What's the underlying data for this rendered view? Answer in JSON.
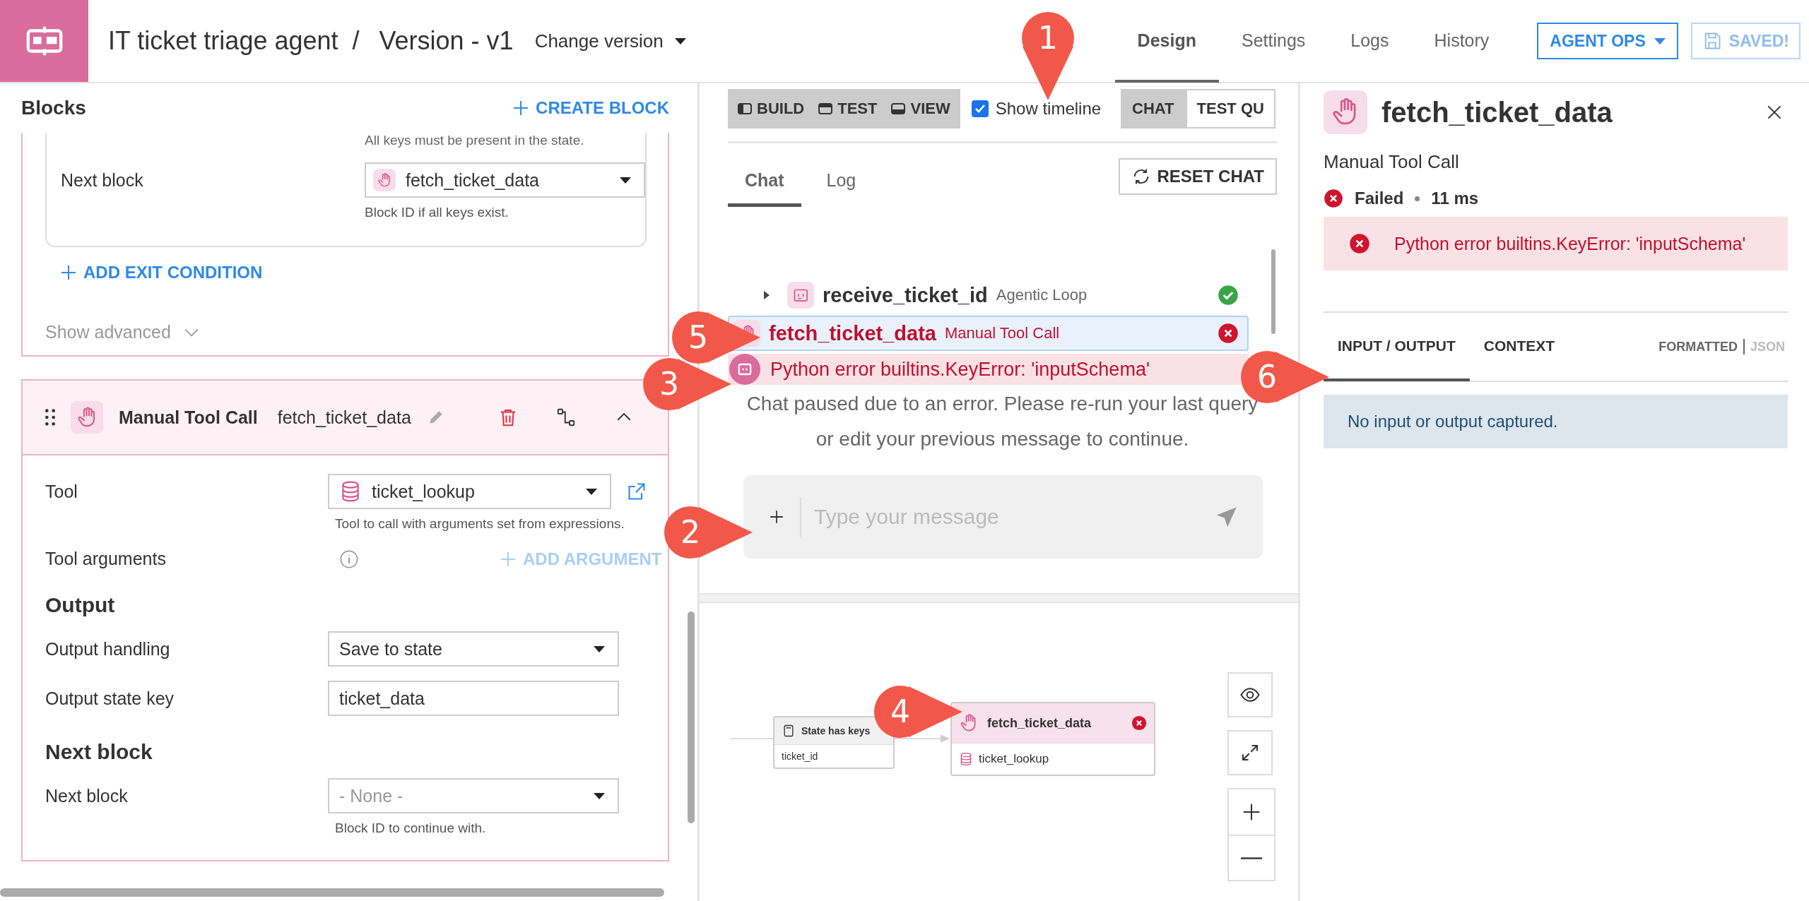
{
  "header": {
    "title": "IT ticket triage agent",
    "separator": "/",
    "version": "Version - v1",
    "change_version": "Change version",
    "tabs": [
      {
        "label": "Design",
        "selected": true
      },
      {
        "label": "Settings",
        "selected": false
      },
      {
        "label": "Logs",
        "selected": false
      },
      {
        "label": "History",
        "selected": false
      }
    ],
    "agent_ops": "AGENT OPS",
    "save": {
      "label": "SAVED!",
      "disabled": true
    }
  },
  "blocks_panel": {
    "title": "Blocks",
    "create": "CREATE BLOCK",
    "exit_condition": {
      "keys_hint": "All keys must be present in the state.",
      "next_label": "Next block",
      "next_value": "fetch_ticket_data",
      "next_hint": "Block ID if all keys exist."
    },
    "add_exit": "ADD EXIT CONDITION",
    "show_advanced": "Show advanced",
    "block": {
      "type": "Manual Tool Call",
      "name": "fetch_ticket_data",
      "expanded": true,
      "tool_label": "Tool",
      "tool_value": "ticket_lookup",
      "tool_hint": "Tool to call with arguments set from expressions.",
      "args_label": "Tool arguments",
      "add_argument": {
        "label": "ADD ARGUMENT",
        "disabled": true
      },
      "output_heading": "Output",
      "handling_label": "Output handling",
      "handling_value": "Save to state",
      "key_label": "Output state key",
      "key_value": "ticket_data",
      "next_heading": "Next block",
      "next_label": "Next block",
      "next_placeholder": "- None -",
      "next_hint": "Block ID to continue with."
    }
  },
  "chat_panel": {
    "modes": [
      "BUILD",
      "TEST",
      "VIEW"
    ],
    "show_timeline": {
      "label": "Show timeline",
      "checked": true
    },
    "views": [
      {
        "label": "CHAT",
        "selected": true
      },
      {
        "label": "TEST QU",
        "selected": false
      }
    ],
    "tabs": [
      {
        "label": "Chat",
        "selected": true
      },
      {
        "label": "Log",
        "selected": false
      }
    ],
    "reset": "RESET CHAT",
    "timeline": [
      {
        "kind": "loop",
        "name": "receive_ticket_id",
        "type": "Agentic Loop",
        "failed": false,
        "selected": false,
        "expanded": false
      },
      {
        "kind": "tool",
        "name": "fetch_ticket_data",
        "type": "Manual Tool Call",
        "failed": true,
        "selected": true
      }
    ],
    "error": "Python error builtins.KeyError: 'inputSchema'",
    "paused": "Chat paused due to an error. Please re-run your last query or edit your previous message to continue.",
    "input": {
      "placeholder": "Type your message"
    }
  },
  "canvas": {
    "nodes": [
      {
        "kind": "condition",
        "title": "State has keys",
        "detail": "ticket_id",
        "failed": false
      },
      {
        "kind": "tool",
        "title": "fetch_ticket_data",
        "detail": "ticket_lookup",
        "failed": true
      }
    ]
  },
  "details_panel": {
    "title": "fetch_ticket_data",
    "subtitle": "Manual Tool Call",
    "status": "Failed",
    "failed": true,
    "duration": "11 ms",
    "error": "Python error builtins.KeyError: 'inputSchema'",
    "tabs": [
      {
        "label": "INPUT / OUTPUT",
        "selected": true
      },
      {
        "label": "CONTEXT",
        "selected": false
      }
    ],
    "formats": [
      {
        "label": "FORMATTED",
        "selected": true
      },
      {
        "label": "JSON",
        "selected": false
      }
    ],
    "empty": "No input or output captured."
  },
  "callouts": [
    {
      "label": "1",
      "kind": "down"
    },
    {
      "label": "2",
      "kind": "right"
    },
    {
      "label": "3",
      "kind": "right"
    },
    {
      "label": "4",
      "kind": "right"
    },
    {
      "label": "5",
      "kind": "right"
    },
    {
      "label": "6",
      "kind": "right"
    }
  ]
}
